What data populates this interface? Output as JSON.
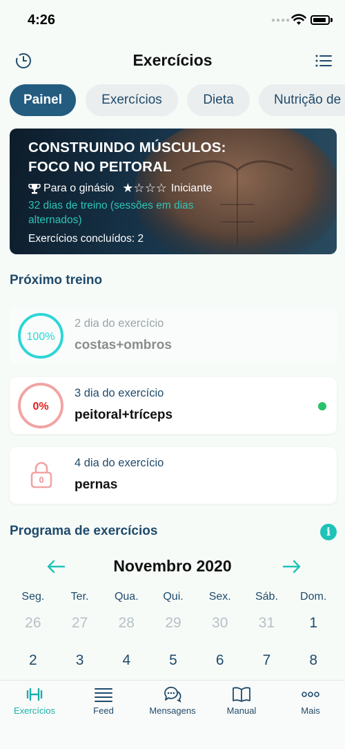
{
  "status_bar": {
    "time": "4:26"
  },
  "header": {
    "title": "Exercícios"
  },
  "tabs": [
    {
      "label": "Painel",
      "active": true
    },
    {
      "label": "Exercícios",
      "active": false
    },
    {
      "label": "Dieta",
      "active": false
    },
    {
      "label": "Nutrição de",
      "active": false
    }
  ],
  "program_card": {
    "title_line1": "CONSTRUINDO MÚSCULOS:",
    "title_line2": "FOCO NO PEITORAL",
    "location": "Para o ginásio",
    "rating_filled": 1,
    "rating_total": 4,
    "level": "Iniciante",
    "schedule": "32 dias de treino (sessões em dias alternados)",
    "completed_label": "Exercícios concluídos:",
    "completed_value": "2"
  },
  "next_workout": {
    "title": "Próximo treino",
    "items": [
      {
        "progress_text": "100%",
        "day": "2 dia do exercício",
        "name": "costas+ombros",
        "state": "done"
      },
      {
        "progress_text": "0%",
        "day": "3 dia do exercício",
        "name": "peitoral+tríceps",
        "state": "current"
      },
      {
        "progress_text": "",
        "day": "4 dia do exercício",
        "name": "pernas",
        "state": "locked"
      }
    ]
  },
  "program": {
    "title": "Programa de exercícios",
    "info_icon": "i"
  },
  "calendar": {
    "month": "Novembro 2020",
    "weekdays": [
      "Seg.",
      "Ter.",
      "Qua.",
      "Qui.",
      "Sex.",
      "Sáb.",
      "Dom."
    ],
    "week1": [
      "26",
      "27",
      "28",
      "29",
      "30",
      "31",
      "1"
    ],
    "week2": [
      "2",
      "3",
      "4",
      "5",
      "6",
      "7",
      "8"
    ]
  },
  "bottom_nav": [
    {
      "label": "Exercícios",
      "icon": "dumbbell-icon",
      "active": true
    },
    {
      "label": "Feed",
      "icon": "menu-lines-icon",
      "active": false
    },
    {
      "label": "Mensagens",
      "icon": "chat-icon",
      "active": false
    },
    {
      "label": "Manual",
      "icon": "book-icon",
      "active": false
    },
    {
      "label": "Mais",
      "icon": "more-dots-icon",
      "active": false
    }
  ],
  "colors": {
    "primary": "#245c80",
    "teal": "#1ec3b7",
    "done_ring": "#2ed5d8",
    "pending_ring": "#f2a3a3",
    "pending_text": "#e02020",
    "status_green": "#27c26a"
  }
}
